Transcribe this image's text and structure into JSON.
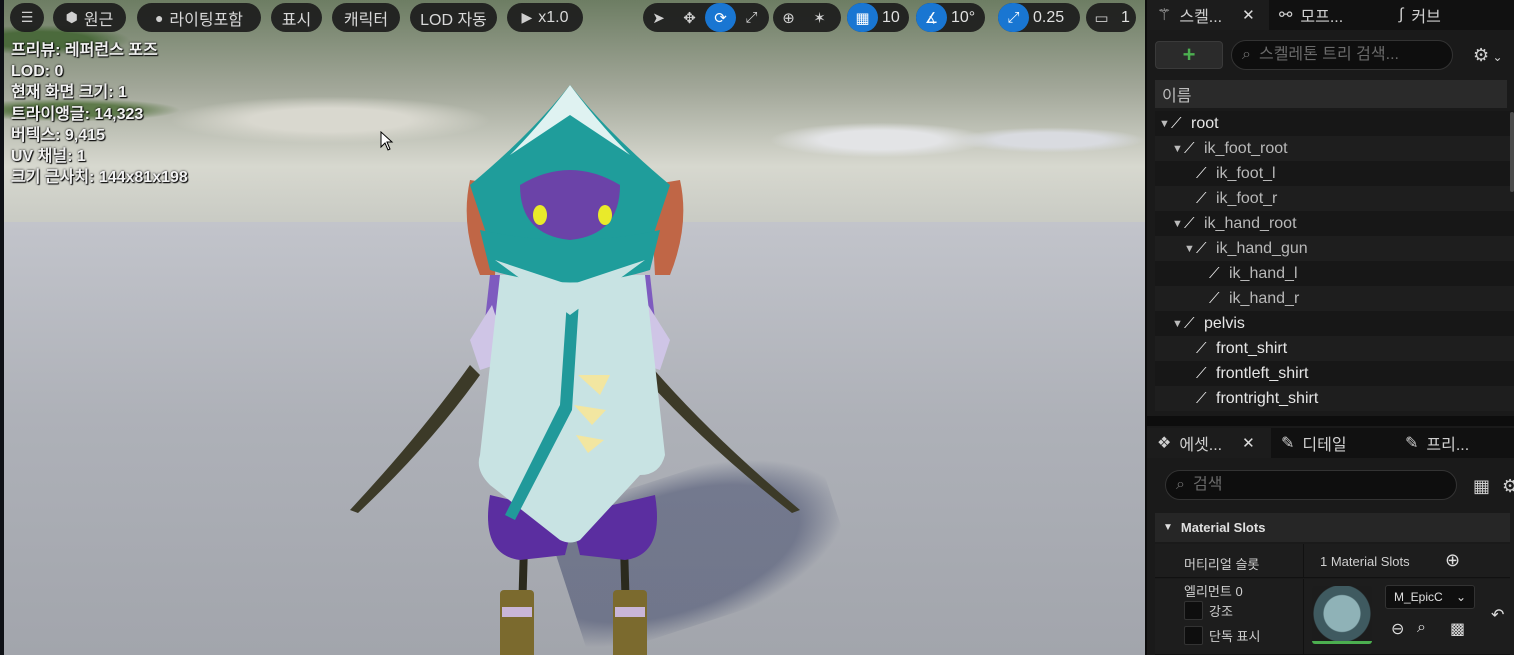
{
  "viewport_toolbar": {
    "menu_icon": "hamburger-icon",
    "perspective_label": "원근",
    "lighting_label": "라이팅포함",
    "show_label": "표시",
    "character_label": "캐릭터",
    "lod_label": "LOD 자동",
    "play_speed": "x1.0",
    "grid_snap_value": "10",
    "rotation_snap_value": "10°",
    "scale_snap_value": "0.25",
    "camera_speed_value": "1"
  },
  "stats": {
    "preview": "프리뷰: 레퍼런스 포즈",
    "lod": "LOD: 0",
    "screen_size": "현재 화면 크기: 1",
    "triangles": "트라이앵글: 14,323",
    "vertices": "버텍스: 9,415",
    "uv_channels": "UV 채널: 1",
    "approx_size": "크기 근사치: 144x81x198"
  },
  "skeleton_panel": {
    "tabs": [
      {
        "label": "스켈...",
        "icon": "skeleton-icon"
      },
      {
        "label": "모프...",
        "icon": "morph-icon"
      },
      {
        "label": "커브",
        "icon": "curve-icon"
      }
    ],
    "search_placeholder": "스켈레톤 트리 검색...",
    "column_name": "이름",
    "bones": [
      {
        "name": "root",
        "expanded": true
      },
      {
        "name": "ik_foot_root",
        "expanded": true
      },
      {
        "name": "ik_foot_l",
        "expanded": false
      },
      {
        "name": "ik_foot_r",
        "expanded": false
      },
      {
        "name": "ik_hand_root",
        "expanded": true
      },
      {
        "name": "ik_hand_gun",
        "expanded": true
      },
      {
        "name": "ik_hand_l",
        "expanded": false
      },
      {
        "name": "ik_hand_r",
        "expanded": false
      },
      {
        "name": "pelvis",
        "expanded": true
      },
      {
        "name": "front_shirt",
        "expanded": false
      },
      {
        "name": "frontleft_shirt",
        "expanded": false
      },
      {
        "name": "frontright_shirt",
        "expanded": false
      }
    ]
  },
  "details_panel": {
    "tabs": [
      {
        "label": "에셋...",
        "icon": "asset-icon"
      },
      {
        "label": "디테일",
        "icon": "pencil-icon"
      },
      {
        "label": "프리...",
        "icon": "pencil-icon"
      }
    ],
    "search_placeholder": "검색",
    "section_title": "Material Slots",
    "material_slots_label": "머티리얼 슬롯",
    "material_slots_value": "1 Material Slots",
    "element_label": "엘리먼트 0",
    "highlight_label": "강조",
    "isolate_label": "단독 표시",
    "material_name": "M_EpicC"
  }
}
